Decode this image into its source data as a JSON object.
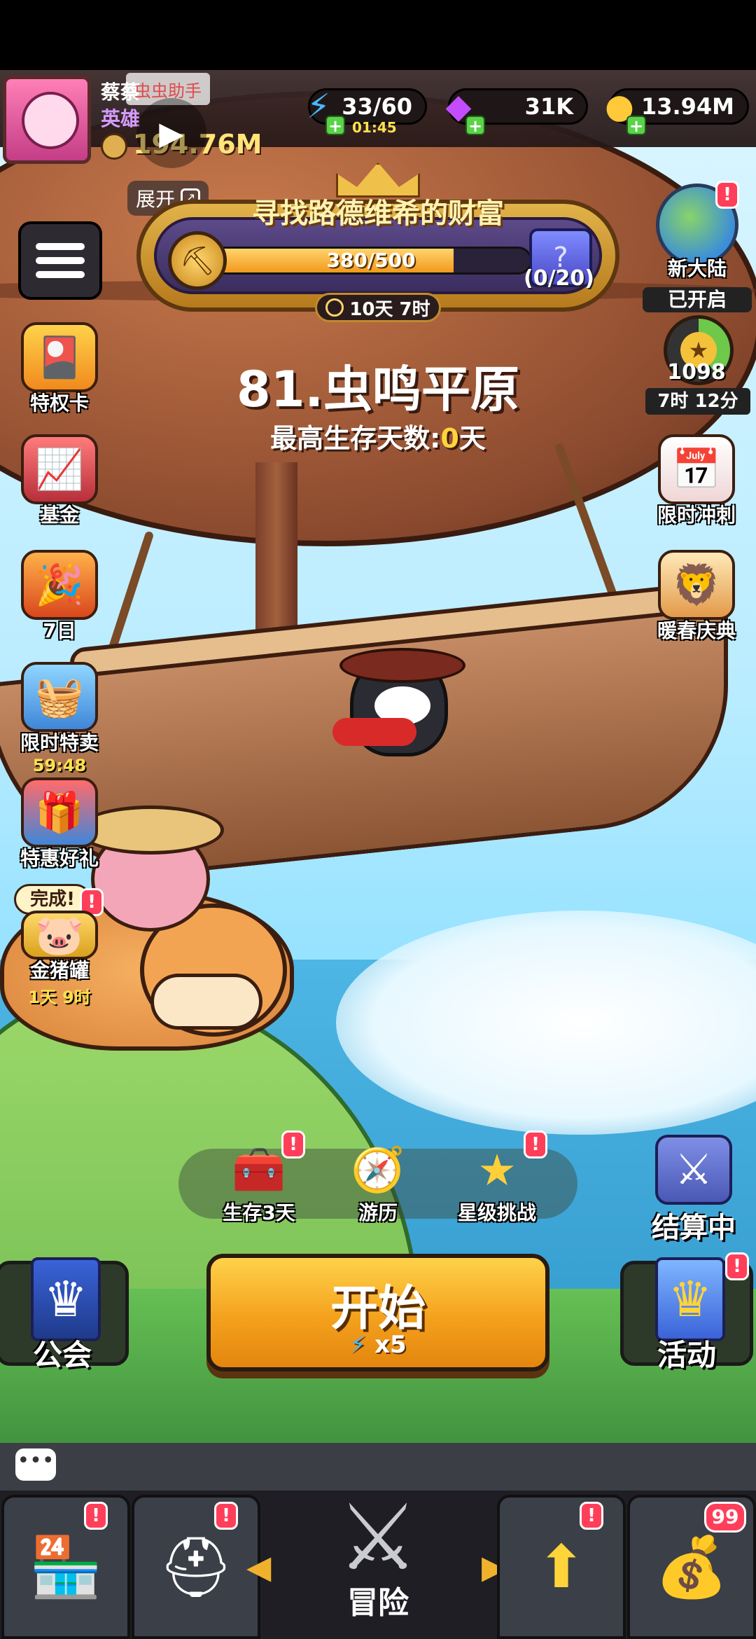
{
  "player": {
    "name": "蔡蔡",
    "rank": "英雄",
    "power": "194.76M",
    "assistant_label": "虫虫助手"
  },
  "resources": {
    "energy": "33/60",
    "energy_timer": "01:45",
    "gems": "31K",
    "gold": "13.94M"
  },
  "event": {
    "title": "寻找路德维希的财富",
    "progress_text": "380/500",
    "progress_fraction": 0.76,
    "reward_count": "(0/20)",
    "timer": "10天 7时",
    "expand_label": "展开"
  },
  "stage": {
    "name": "81.虫鸣平原",
    "best_prefix": "最高生存天数:",
    "best_value": "0",
    "best_suffix": "天"
  },
  "left_menu": [
    {
      "label": "特权卡",
      "icon": "privilege-card-icon"
    },
    {
      "label": "基金",
      "icon": "fund-icon"
    },
    {
      "label": "7日",
      "icon": "seven-day-icon"
    },
    {
      "label": "限时特卖",
      "sub": "59:48",
      "icon": "limited-sale-icon"
    },
    {
      "label": "特惠好礼",
      "icon": "special-gift-icon"
    },
    {
      "label": "金猪罐",
      "sub": "1天 9时",
      "done": "完成!",
      "icon": "golden-pig-icon"
    }
  ],
  "right_menu": {
    "new_continent": {
      "label": "新大陆",
      "status": "已开启"
    },
    "xp": {
      "value": "1098",
      "timer": "7时 12分"
    },
    "sprint": {
      "label": "限时冲刺"
    },
    "spring": {
      "label": "暖春庆典"
    }
  },
  "tray": [
    {
      "label": "生存3天",
      "icon": "chest-icon"
    },
    {
      "label": "游历",
      "icon": "compass-icon"
    },
    {
      "label": "星级挑战",
      "icon": "star-icon"
    }
  ],
  "settling": {
    "label": "结算中"
  },
  "start": {
    "label": "开始",
    "cost": "x5"
  },
  "guild": {
    "label": "公会"
  },
  "activity": {
    "label": "活动"
  },
  "nav": {
    "center_label": "冒险",
    "chest_badge": "99"
  },
  "colors": {
    "accent_orange": "#f4a11d",
    "badge_red": "#ff3e5a",
    "gold_text": "#ffe47a"
  }
}
